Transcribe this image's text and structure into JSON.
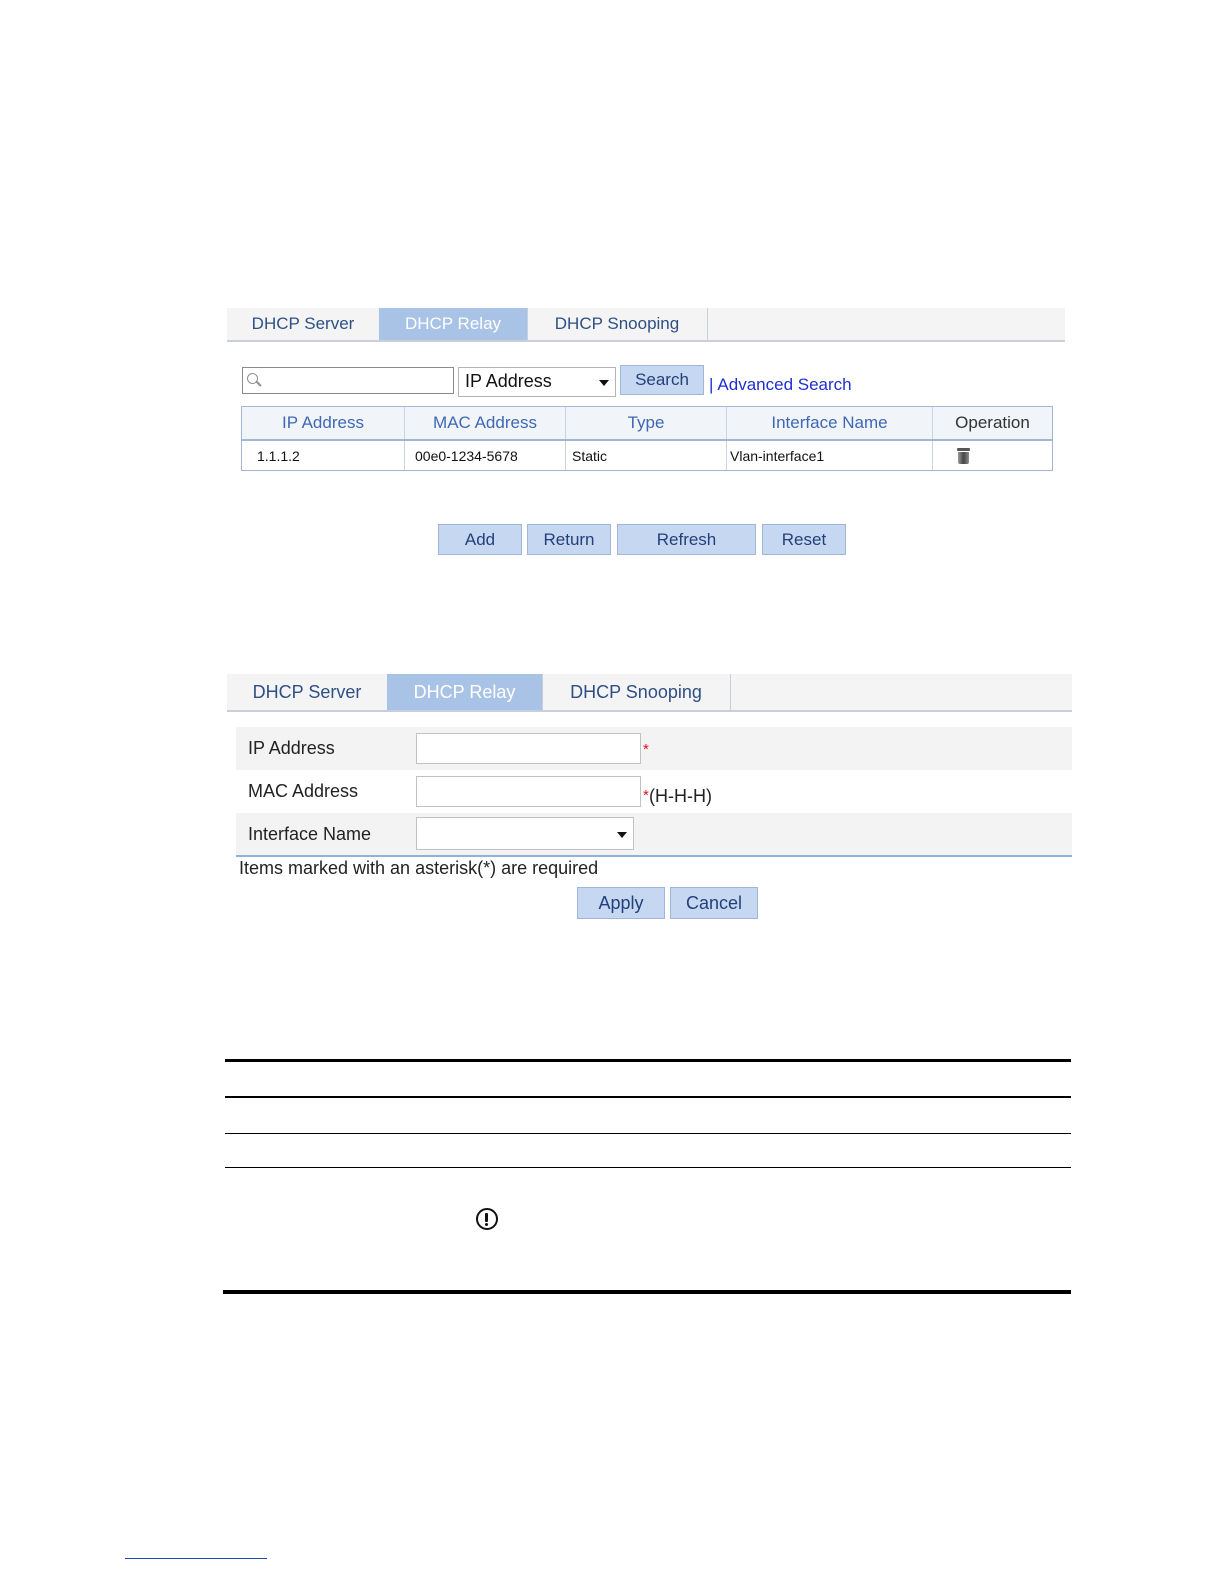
{
  "screen1": {
    "tabs": [
      {
        "label": "DHCP Server",
        "active": false
      },
      {
        "label": "DHCP Relay",
        "active": true
      },
      {
        "label": "DHCP Snooping",
        "active": false
      }
    ],
    "search": {
      "value": "",
      "placeholder": ""
    },
    "field_select": {
      "selected": "IP Address"
    },
    "search_button": "Search",
    "advanced_separator": "|",
    "advanced_search": "Advanced Search",
    "table": {
      "columns": [
        "IP Address",
        "MAC Address",
        "Type",
        "Interface Name",
        "Operation"
      ],
      "rows": [
        {
          "ip": "1.1.1.2",
          "mac": "00e0-1234-5678",
          "type": "Static",
          "interface": "Vlan-interface1",
          "operation_icon": "trash-icon"
        }
      ]
    },
    "buttons": {
      "add": "Add",
      "return": "Return",
      "refresh": "Refresh",
      "reset": "Reset"
    }
  },
  "screen2": {
    "tabs": [
      {
        "label": "DHCP Server",
        "active": false
      },
      {
        "label": "DHCP Relay",
        "active": true
      },
      {
        "label": "DHCP Snooping",
        "active": false
      }
    ],
    "form": {
      "ip_label": "IP Address",
      "ip_value": "",
      "ip_required": "*",
      "mac_label": "MAC Address",
      "mac_value": "",
      "mac_required": "*",
      "mac_hint": "(H-H-H)",
      "interface_label": "Interface Name",
      "interface_selected": ""
    },
    "required_note": "Items marked with an asterisk(*) are required",
    "buttons": {
      "apply": "Apply",
      "cancel": "Cancel"
    }
  },
  "document": {
    "notice_icon": "caution-icon"
  },
  "colors": {
    "active_tab": "#a9c3e6",
    "button": "#c6d8f1",
    "link": "#1e2fd0",
    "header_text": "#3f68b6",
    "required": "#e0121a"
  }
}
